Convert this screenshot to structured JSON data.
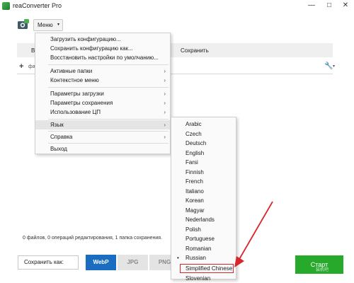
{
  "window": {
    "title": "reaConverter Pro",
    "controls": {
      "minimize": "—",
      "maximize": "□",
      "close": "✕"
    }
  },
  "toolbar": {
    "menu_label": "Меню",
    "menu_caret": "▾"
  },
  "tabs": {
    "left_partial": "В",
    "save": "Сохранить"
  },
  "subtoolbar": {
    "add_icon": "+",
    "add_text_partial": "фа",
    "wrench_icon": "🔧",
    "caret": "▾"
  },
  "status": {
    "text": "0 файлов, 0 операций редактирования, 1 папка сохранения."
  },
  "bottom": {
    "save_as_label": "Сохранить как:",
    "formats": [
      "WebP",
      "JPG",
      "PNG"
    ],
    "start_label": "Старт",
    "watermark": "装机吧"
  },
  "main_menu": {
    "items": [
      {
        "label": "Загрузить конфигурацию...",
        "arrow": ""
      },
      {
        "label": "Сохранить конфигурацию как...",
        "arrow": ""
      },
      {
        "label": "Восстановить настройки по умолчанию...",
        "arrow": ""
      },
      {
        "label": "Активные папки",
        "arrow": "›"
      },
      {
        "label": "Контекстное меню",
        "arrow": "›"
      },
      {
        "label": "Параметры загрузки",
        "arrow": "›"
      },
      {
        "label": "Параметры сохранения",
        "arrow": "›"
      },
      {
        "label": "Использование ЦП",
        "arrow": "›"
      },
      {
        "label": "Язык",
        "arrow": "›"
      },
      {
        "label": "Справка",
        "arrow": "›"
      },
      {
        "label": "Выход",
        "arrow": ""
      }
    ]
  },
  "language_menu": {
    "items": [
      "Arabic",
      "Czech",
      "Deutsch",
      "English",
      "Farsi",
      "Finnish",
      "French",
      "Italiano",
      "Korean",
      "Magyar",
      "Nederlands",
      "Polish",
      "Portuguese",
      "Romanian",
      "Russian",
      "Simplified Chinese",
      "Slovenian"
    ],
    "bullet": "•",
    "selected": "Russian",
    "highlighted": "Simplified Chinese"
  },
  "colors": {
    "accent": "#1b6dc1",
    "start": "#27a92b",
    "annotation": "#d9262c"
  }
}
